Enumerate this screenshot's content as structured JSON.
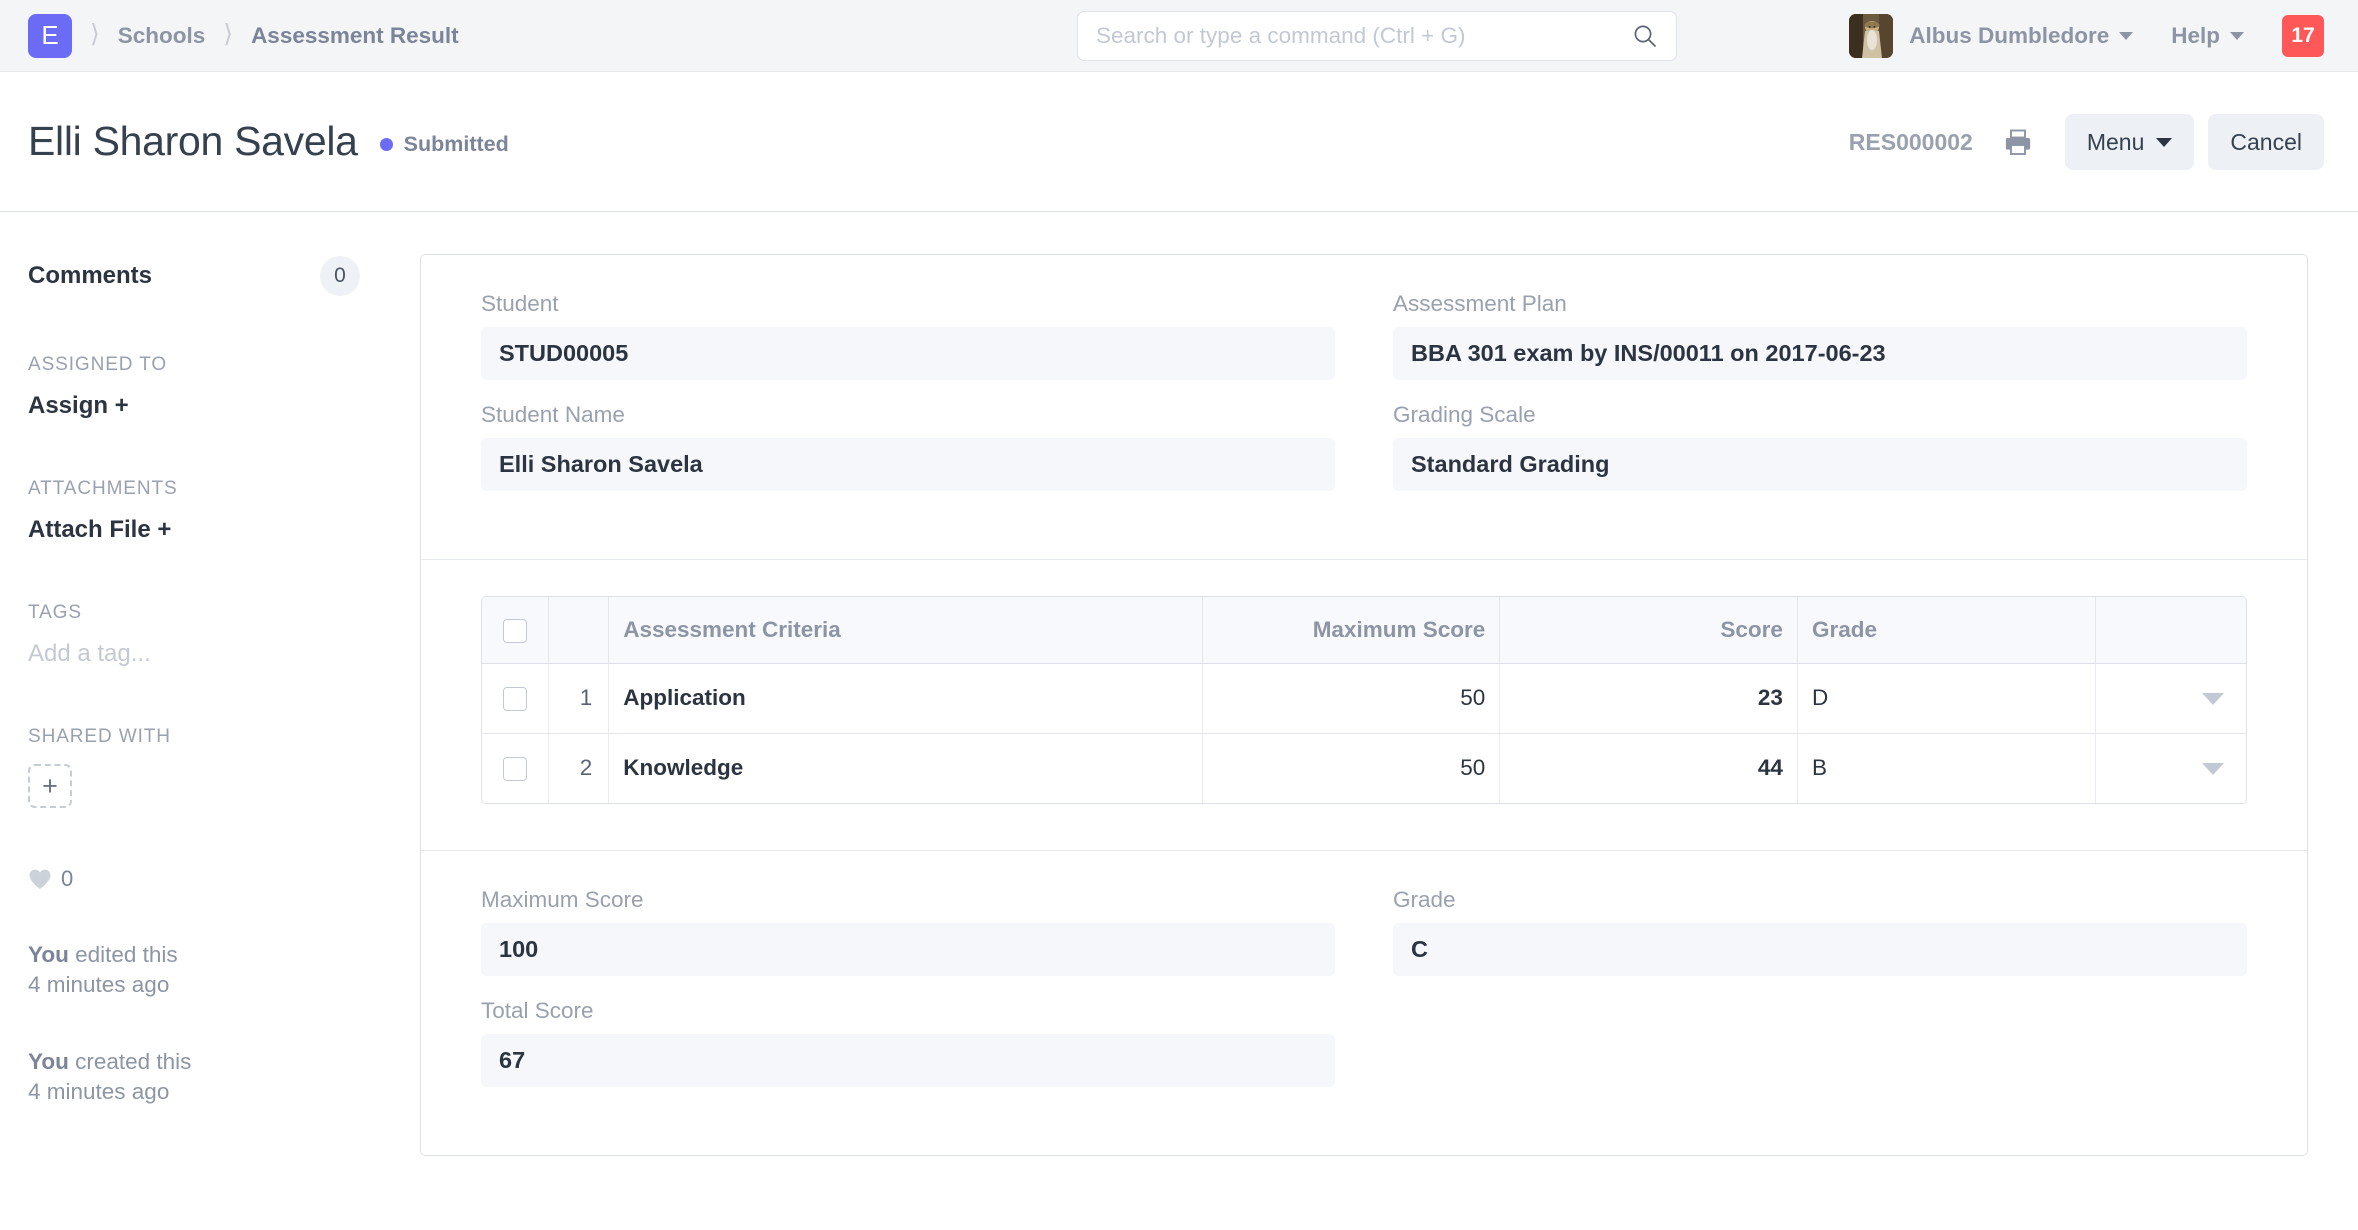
{
  "navbar": {
    "logo_letter": "E",
    "breadcrumb": [
      "Schools",
      "Assessment Result"
    ],
    "search_placeholder": "Search or type a command (Ctrl + G)",
    "user_name": "Albus Dumbledore",
    "help_label": "Help",
    "notification_count": "17"
  },
  "header": {
    "title": "Elli Sharon Savela",
    "status": "Submitted",
    "status_color": "#6b6bf5",
    "doc_id": "RES000002",
    "menu_label": "Menu",
    "cancel_label": "Cancel"
  },
  "sidebar": {
    "comments_label": "Comments",
    "comments_count": "0",
    "assigned_to_label": "ASSIGNED TO",
    "assign_action": "Assign +",
    "attachments_label": "ATTACHMENTS",
    "attach_action": "Attach File +",
    "tags_label": "TAGS",
    "tags_placeholder": "Add a tag...",
    "shared_with_label": "SHARED WITH",
    "share_add": "+",
    "like_count": "0",
    "activity": [
      {
        "actor": "You",
        "action": " edited this",
        "time": "4 minutes ago"
      },
      {
        "actor": "You",
        "action": " created this",
        "time": "4 minutes ago"
      }
    ]
  },
  "form": {
    "student_label": "Student",
    "student_value": "STUD00005",
    "student_name_label": "Student Name",
    "student_name_value": "Elli Sharon Savela",
    "assessment_plan_label": "Assessment Plan",
    "assessment_plan_value": "BBA 301 exam by INS/00011 on 2017-06-23",
    "grading_scale_label": "Grading Scale",
    "grading_scale_value": "Standard Grading",
    "maximum_score_label": "Maximum Score",
    "maximum_score_value": "100",
    "total_score_label": "Total Score",
    "total_score_value": "67",
    "grade_label": "Grade",
    "grade_value": "C"
  },
  "table": {
    "columns": [
      "Assessment Criteria",
      "Maximum Score",
      "Score",
      "Grade"
    ],
    "rows": [
      {
        "idx": "1",
        "criteria": "Application",
        "max_score": "50",
        "score": "23",
        "grade": "D"
      },
      {
        "idx": "2",
        "criteria": "Knowledge",
        "max_score": "50",
        "score": "44",
        "grade": "B"
      }
    ]
  }
}
